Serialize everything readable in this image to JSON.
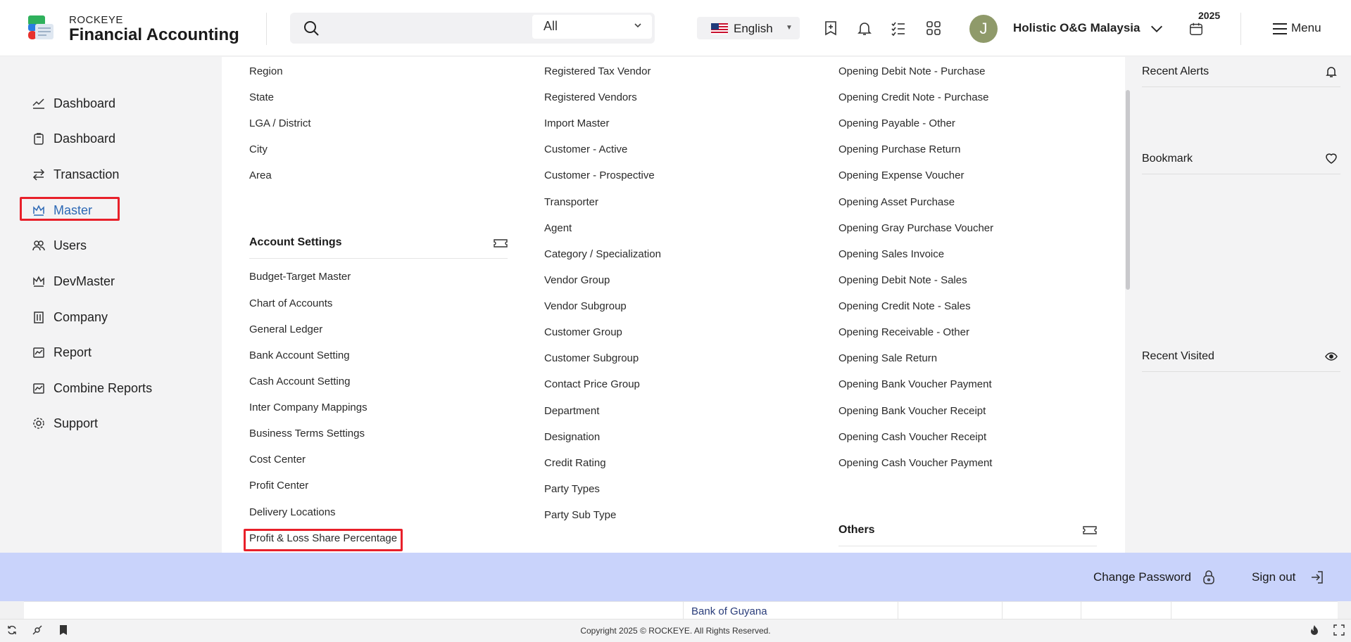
{
  "header": {
    "brand_small": "ROCKEYE",
    "brand_big": "Financial Accounting",
    "search_scope": "All",
    "language": "English",
    "avatar_initial": "J",
    "company": "Holistic O&G Malaysia",
    "year": "2025",
    "menu_label": "Menu"
  },
  "sidebar": {
    "items": [
      {
        "label": "Dashboard",
        "icon": "trend-icon"
      },
      {
        "label": "Dashboard",
        "icon": "clipboard-icon"
      },
      {
        "label": "Transaction",
        "icon": "swap-icon"
      },
      {
        "label": "Master",
        "icon": "crown-icon",
        "active": true
      },
      {
        "label": "Users",
        "icon": "users-icon"
      },
      {
        "label": "DevMaster",
        "icon": "crown-icon"
      },
      {
        "label": "Company",
        "icon": "building-icon"
      },
      {
        "label": "Report",
        "icon": "report-icon"
      },
      {
        "label": "Combine Reports",
        "icon": "report-icon"
      },
      {
        "label": "Support",
        "icon": "gear-icon"
      }
    ]
  },
  "mega": {
    "col1_top": [
      "Region",
      "State",
      "LGA / District",
      "City",
      "Area"
    ],
    "account_settings_title": "Account Settings",
    "account_settings": [
      "Budget-Target Master",
      "Chart of Accounts",
      "General Ledger",
      "Bank Account Setting",
      "Cash Account Setting",
      "Inter Company Mappings",
      "Business Terms Settings",
      "Cost Center",
      "Profit Center",
      "Delivery Locations",
      "Profit & Loss Share Percentage"
    ],
    "col2": [
      "Registered Tax Vendor",
      "Registered Vendors",
      "Import Master",
      "Customer - Active",
      "Customer - Prospective",
      "Transporter",
      "Agent",
      "Category / Specialization",
      "Vendor Group",
      "Vendor Subgroup",
      "Customer Group",
      "Customer Subgroup",
      "Contact Price Group",
      "Department",
      "Designation",
      "Credit Rating",
      "Party Types",
      "Party Sub Type"
    ],
    "col3": [
      "Opening Debit Note - Purchase",
      "Opening Credit Note - Purchase",
      "Opening Payable - Other",
      "Opening Purchase Return",
      "Opening Expense Voucher",
      "Opening Asset Purchase",
      "Opening Gray Purchase Voucher",
      "Opening Sales Invoice",
      "Opening Debit Note - Sales",
      "Opening Credit Note - Sales",
      "Opening Receivable - Other",
      "Opening Sale Return",
      "Opening Bank Voucher Payment",
      "Opening Bank Voucher Receipt",
      "Opening Cash Voucher Receipt",
      "Opening Cash Voucher Payment"
    ],
    "others_title": "Others"
  },
  "right_panel": {
    "recent_alerts": "Recent Alerts",
    "bookmark": "Bookmark",
    "recent_visited": "Recent Visited"
  },
  "account_bar": {
    "change_password": "Change Password",
    "sign_out": "Sign out"
  },
  "behind": {
    "bank_text": "Bank of Guyana"
  },
  "footer": {
    "copyright": "Copyright 2025 © ROCKEYE. All Rights Reserved."
  },
  "colors": {
    "accent": "#2d69b5",
    "highlight": "#e8202a",
    "account_bar": "#c9d3fb"
  }
}
